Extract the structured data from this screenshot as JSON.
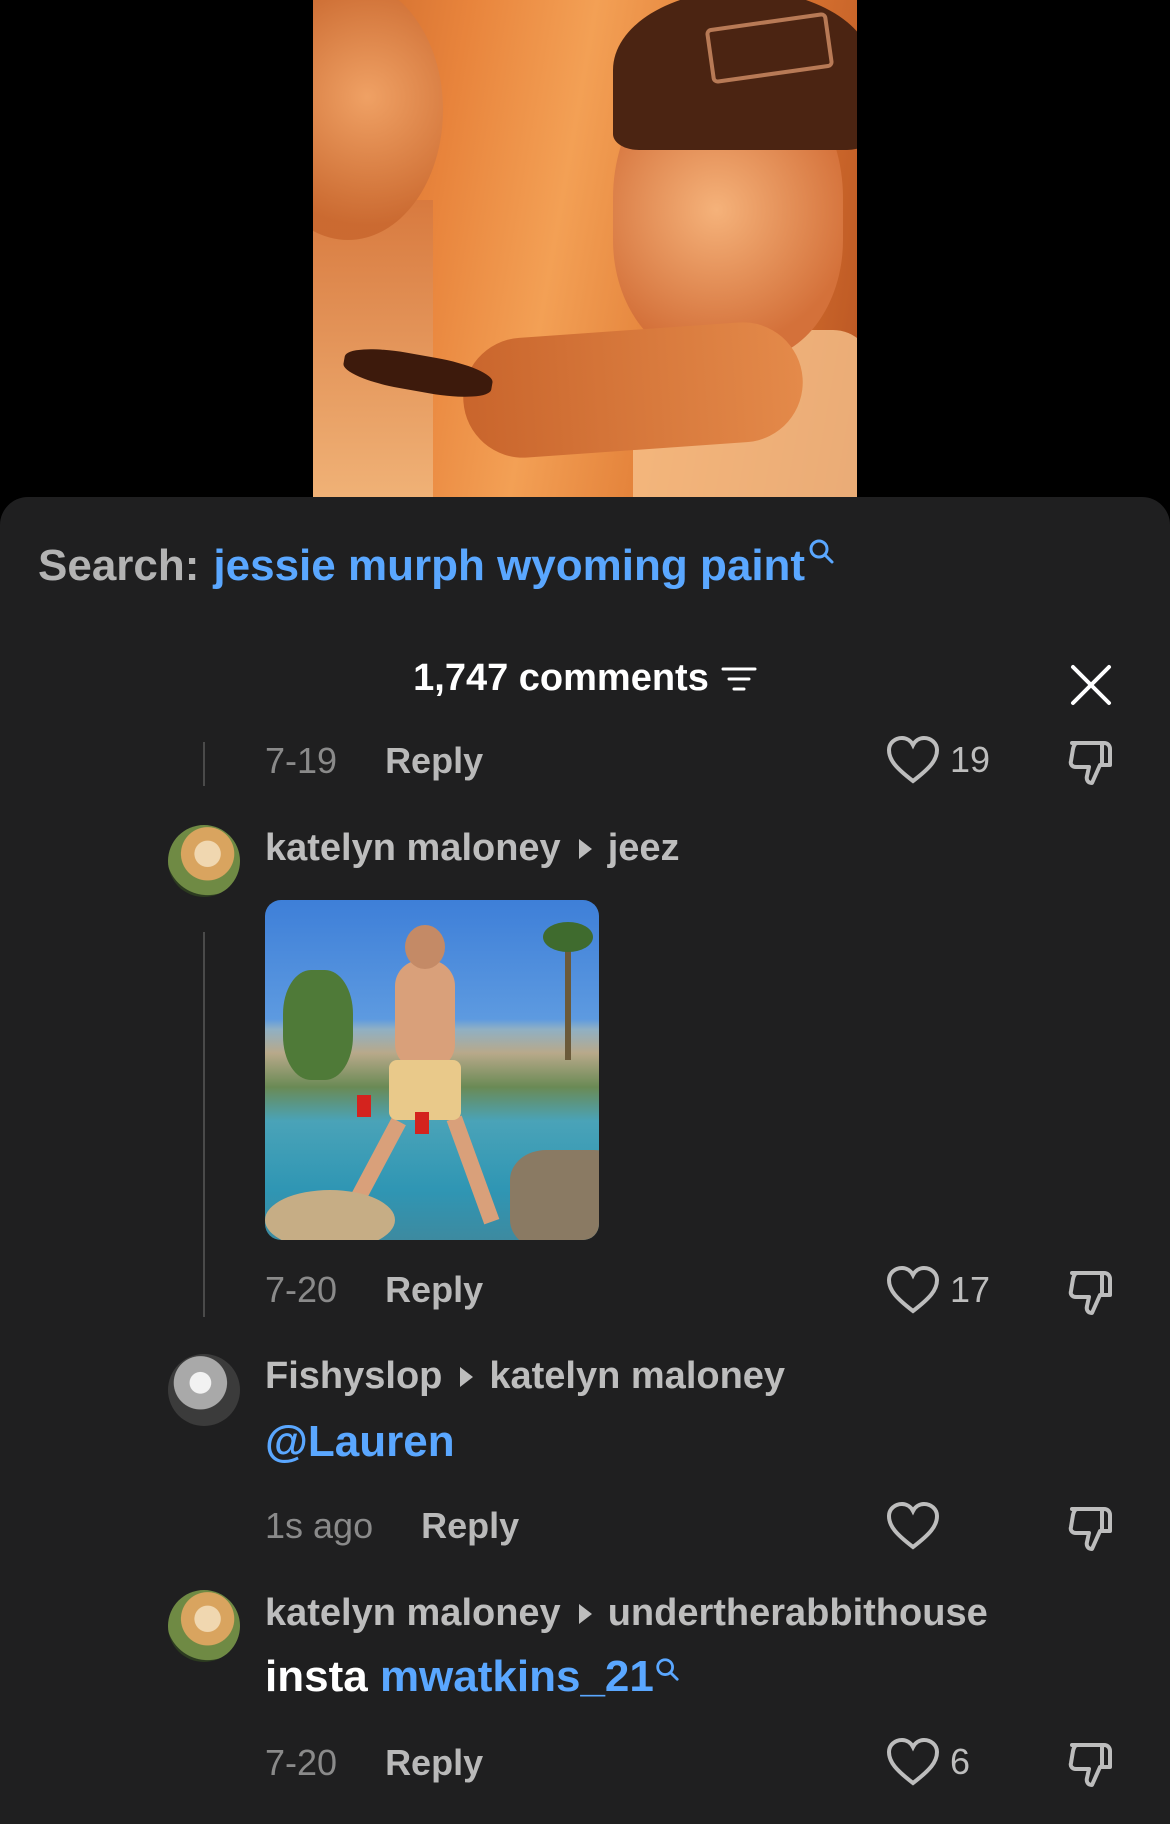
{
  "search": {
    "label": "Search:",
    "query": "jessie murph wyoming paint"
  },
  "comments_header": {
    "count_label": "1,747 comments"
  },
  "comments": [
    {
      "date": "7-19",
      "reply_label": "Reply",
      "likes": "19"
    },
    {
      "author": "katelyn maloney",
      "reply_to": "jeez",
      "has_image": true,
      "date": "7-20",
      "reply_label": "Reply",
      "likes": "17"
    },
    {
      "author": "Fishyslop",
      "reply_to": "katelyn maloney",
      "mention": "@Lauren",
      "date": "1s ago",
      "reply_label": "Reply",
      "likes": ""
    },
    {
      "author": "katelyn maloney",
      "reply_to": "undertherabbithouse",
      "text": "insta",
      "link": "mwatkins_21",
      "date": "7-20",
      "reply_label": "Reply",
      "likes": "6"
    }
  ],
  "colors": {
    "background": "#1f1f20",
    "link": "#5aa7ff",
    "muted": "#8a8a8a"
  },
  "icons": [
    "search-icon",
    "filter-icon",
    "close-icon",
    "heart-icon",
    "dislike-icon"
  ]
}
